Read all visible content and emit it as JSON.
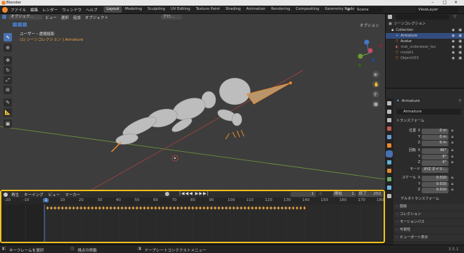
{
  "window": {
    "title": "Blender"
  },
  "menu": [
    "ファイル",
    "編集",
    "レンダー",
    "ウィンドウ",
    "ヘルプ"
  ],
  "workspaces": [
    "Layout",
    "Modeling",
    "Sculpting",
    "UV Editing",
    "Texture Paint",
    "Shading",
    "Animation",
    "Rendering",
    "Compositing",
    "Geometry Nodes",
    "Scripting"
  ],
  "scene": "Scene",
  "viewlayer": "ViewLayer",
  "viewport": {
    "mode": "オブジェク...",
    "global": "グロ...",
    "menu": [
      "ビュー",
      "選択",
      "追加",
      "オブジェクト"
    ],
    "persp": "ユーザー・透視投影",
    "collection": "(1) シーンコレクション | Armature",
    "options": "オプション"
  },
  "outliner": {
    "root": "シーンコレクション",
    "items": [
      "Collection",
      "Armature",
      "Avatar",
      "mat_underwear_tex",
      "model1",
      "Object003"
    ]
  },
  "props": {
    "obj": "Armature",
    "data": "Armature",
    "transform": "トランスフォーム",
    "loc": "位置",
    "rot": "回転",
    "mode_label": "モード",
    "scale_label": "スケール",
    "axes": [
      "X",
      "Y",
      "Z"
    ],
    "loc_vals": [
      "0 m",
      "0 m",
      "0 m"
    ],
    "rot_vals": [
      "90°",
      "0°",
      "0°"
    ],
    "mode": "XYZ オイラ...",
    "scale_vals": [
      "0.010",
      "0.010",
      "0.010"
    ],
    "delta": "デルタトランスフォーム",
    "sections": [
      "関係",
      "コレクション",
      "モーションパス",
      "可視性",
      "ビューポート表示"
    ]
  },
  "timeline": {
    "menu": [
      "再生",
      "キーイング",
      "ビュー",
      "マーカー"
    ],
    "current": "1",
    "start_label": "開始",
    "start": "1",
    "end_label": "終了",
    "end": "250",
    "ticks": [
      "-20",
      "-10",
      "1",
      "10",
      "20",
      "30",
      "40",
      "50",
      "60",
      "70",
      "80",
      "90",
      "100",
      "110",
      "120",
      "130",
      "140",
      "150",
      "160",
      "170",
      "180"
    ],
    "keys_end": 140
  },
  "status": {
    "left": "キーフレームを選択",
    "mid": "視点の移動",
    "right": "ドープシートコンテクストメニュー",
    "version": "3.5.1"
  },
  "colors": {
    "accent": "#4772b3",
    "highlight": "#f3c21b",
    "orange": "#f0892b"
  }
}
